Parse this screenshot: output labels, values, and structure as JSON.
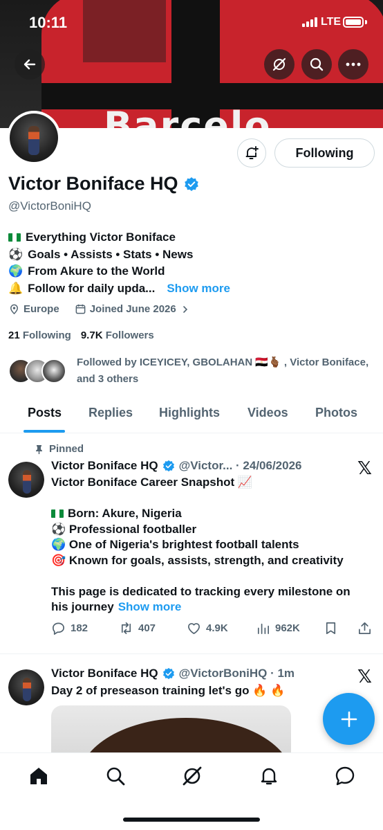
{
  "status_bar": {
    "time": "10:11",
    "network": "LTE"
  },
  "banner": {
    "text": "Barcelo"
  },
  "profile": {
    "name": "Victor Boniface HQ",
    "handle": "@VictorBoniHQ",
    "following_button": "Following",
    "bio": [
      {
        "emoji": "flag",
        "text": "Everything Victor Boniface"
      },
      {
        "emoji": "⚽",
        "text": "Goals • Assists • Stats • News"
      },
      {
        "emoji": "🌍",
        "text": "From Akure to the World"
      },
      {
        "emoji": "🔔",
        "text": "Follow for daily upda..."
      }
    ],
    "show_more": "Show more",
    "location": "Europe",
    "joined": "Joined June 2026",
    "following_count": "21",
    "following_label": "Following",
    "followers_count": "9.7K",
    "followers_label": "Followers",
    "followed_by": "Followed by ICEYICEY, GBOLAHAN 🇪🇬🫰🏾 , Victor Boniface, and 3 others"
  },
  "tabs": [
    "Posts",
    "Replies",
    "Highlights",
    "Videos",
    "Photos"
  ],
  "posts": [
    {
      "pinned_label": "Pinned",
      "name": "Victor Boniface HQ",
      "meta": "@Victor... · 24/06/2026",
      "lines": [
        "Victor Boniface Career Snapshot 📈",
        "",
        "Born: Akure, Nigeria",
        "⚽ Professional footballer",
        "🌍 One of Nigeria's brightest football talents",
        "🎯 Known for goals, assists, strength, and creativity",
        "",
        "This page is dedicated to tracking every milestone on",
        "his journey"
      ],
      "show_more": "Show more",
      "replies": "182",
      "reposts": "407",
      "likes": "4.9K",
      "views": "962K"
    },
    {
      "name": "Victor Boniface HQ",
      "meta": "@VictorBoniHQ · 1m",
      "text": "Day 2 of preseason training let's go 🔥 🔥"
    }
  ],
  "icons": {
    "back": "arrow-left-icon",
    "grok": "grok-icon",
    "search": "search-icon",
    "more": "more-icon",
    "notifications": "bell-plus-icon",
    "x_logo": "𝕏"
  },
  "colors": {
    "accent": "#1d9bf0",
    "secondary_text": "#536471",
    "text": "#0f1419"
  }
}
